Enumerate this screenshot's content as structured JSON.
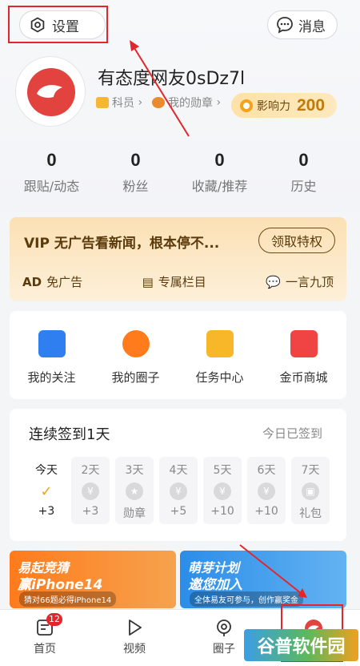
{
  "header": {
    "settings_label": "设置",
    "messages_label": "消息"
  },
  "profile": {
    "nickname": "有态度网友0sDz7l",
    "level_tag": "科员",
    "medal_tag": "我的勋章",
    "influence_label": "影响力",
    "influence_value": "200"
  },
  "stats": [
    {
      "value": "0",
      "label": "跟贴/动态"
    },
    {
      "value": "0",
      "label": "粉丝"
    },
    {
      "value": "0",
      "label": "收藏/推荐"
    },
    {
      "value": "0",
      "label": "历史"
    }
  ],
  "vip": {
    "title": "VIP 无广告看新闻，根本停不...",
    "button": "领取特权",
    "features": [
      {
        "icon_text": "AD",
        "label": "免广告"
      },
      {
        "icon_text": "▤",
        "label": "专属栏目"
      },
      {
        "icon_text": "💬",
        "label": "一言九顶"
      }
    ]
  },
  "shortcuts": [
    {
      "label": "我的关注",
      "icon": "bookmark-icon",
      "color": "#2f7ff0"
    },
    {
      "label": "我的圈子",
      "icon": "circle-chat-icon",
      "color": "#ff7b1c"
    },
    {
      "label": "任务中心",
      "icon": "task-list-icon",
      "color": "#f7b729"
    },
    {
      "label": "金币商城",
      "icon": "shopping-bag-icon",
      "color": "#f04343"
    }
  ],
  "signin": {
    "title": "连续签到1天",
    "status": "今日已签到",
    "days": [
      {
        "day": "今天",
        "reward": "+3",
        "glyph": "✓"
      },
      {
        "day": "2天",
        "reward": "+3",
        "glyph": "¥"
      },
      {
        "day": "3天",
        "reward": "勋章",
        "glyph": "★"
      },
      {
        "day": "4天",
        "reward": "+5",
        "glyph": "¥"
      },
      {
        "day": "5天",
        "reward": "+10",
        "glyph": "¥"
      },
      {
        "day": "6天",
        "reward": "+10",
        "glyph": "¥"
      },
      {
        "day": "7天",
        "reward": "礼包",
        "glyph": "▣"
      }
    ]
  },
  "banners": [
    {
      "line1": "易起竞猜",
      "line2": "赢iPhone14",
      "line3": "猜对66题必得iPhone14"
    },
    {
      "line1": "萌芽计划",
      "line2": "邀您加入",
      "line3": "全体易友可参与，创作赢奖金"
    }
  ],
  "tabbar": {
    "items": [
      {
        "label": "首页",
        "badge": "12"
      },
      {
        "label": "视频"
      },
      {
        "label": "圈子"
      },
      {
        "label": "我"
      }
    ]
  },
  "watermark": "谷普软件园"
}
